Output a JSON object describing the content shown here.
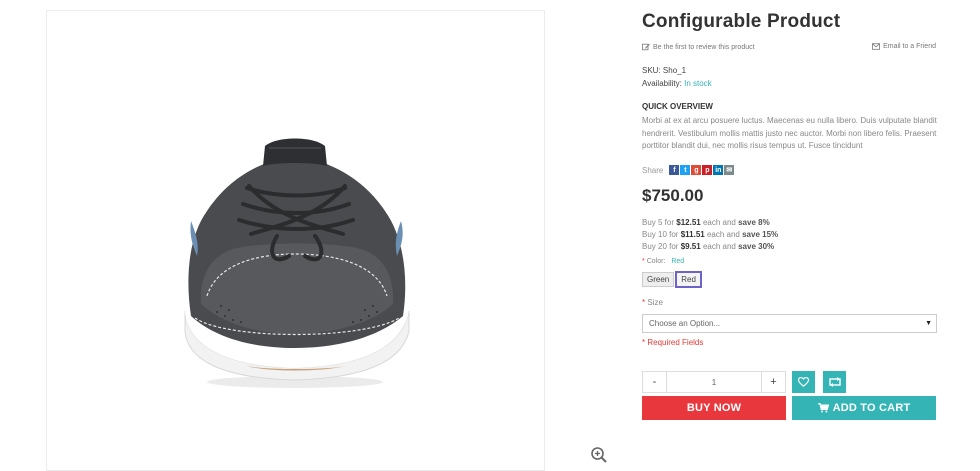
{
  "product": {
    "title": "Configurable Product",
    "review_link": "Be the first to review this product",
    "email_link": "Email to a Friend",
    "sku_label": "SKU:",
    "sku": "Sho_1",
    "availability_label": "Availability:",
    "availability": "In stock",
    "price": "$750.00"
  },
  "overview": {
    "title": "QUICK OVERVIEW",
    "text": "Morbi at ex at arcu posuere luctus. Maecenas eu nulla libero. Duis vulputate blandit hendrerit. Vestibulum mollis mattis justo nec auctor. Morbi non libero felis. Praesent porttitor blandit dui, nec mollis risus tempus ut. Fusce tincidunt"
  },
  "share": {
    "label": "Share",
    "icons": [
      {
        "name": "facebook-icon",
        "glyph": "f",
        "color": "#3b5998"
      },
      {
        "name": "twitter-icon",
        "glyph": "t",
        "color": "#1da1f2"
      },
      {
        "name": "google-plus-icon",
        "glyph": "g",
        "color": "#dd4b39"
      },
      {
        "name": "pinterest-icon",
        "glyph": "p",
        "color": "#cb2027"
      },
      {
        "name": "linkedin-icon",
        "glyph": "in",
        "color": "#0077b5"
      },
      {
        "name": "email-share-icon",
        "glyph": "✉",
        "color": "#7d8a8c"
      }
    ]
  },
  "tiers": [
    {
      "prefix": "Buy 5 for ",
      "price": "$12.51",
      "mid": " each and ",
      "save": "save 8%"
    },
    {
      "prefix": "Buy 10 for ",
      "price": "$11.51",
      "mid": " each and ",
      "save": "save 15%"
    },
    {
      "prefix": "Buy 20 for ",
      "price": "$9.51",
      "mid": " each and ",
      "save": "save 30%"
    }
  ],
  "options": {
    "color_label": "Color:",
    "color_value": "Red",
    "swatches": [
      "Green",
      "Red"
    ],
    "size_label": "Size",
    "size_placeholder": "Choose an Option...",
    "required_fields": "* Required Fields",
    "required_mark": "*"
  },
  "cart": {
    "minus": "-",
    "plus": "+",
    "quantity": "1",
    "buy_now": "BUY NOW",
    "add_to_cart": "ADD TO CART"
  },
  "colors": {
    "accent": "#35b4b6",
    "buy_now": "#e8383d",
    "required": "#e53935"
  }
}
